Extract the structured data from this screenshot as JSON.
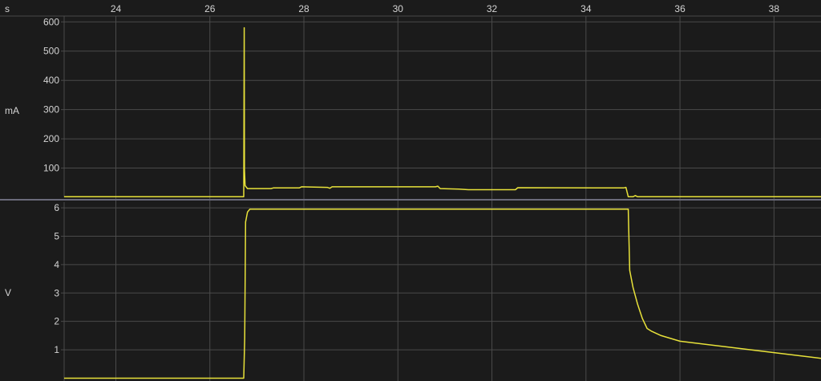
{
  "window": {
    "background": "#1b1b1b",
    "grid_color": "#4a4a4a",
    "divider_color": "#6a6a7a",
    "text_color": "#d4d4d4",
    "trace_color": "#e8e23a"
  },
  "chart_data": [
    {
      "type": "line",
      "panel": "current",
      "xlabel": "s",
      "ylabel": "mA",
      "xlim": [
        22.9,
        39.0
      ],
      "ylim": [
        0,
        620
      ],
      "x_ticks": [
        24,
        26,
        28,
        30,
        32,
        34,
        36,
        38
      ],
      "y_ticks": [
        100,
        200,
        300,
        400,
        500,
        600
      ],
      "grid": true,
      "series": [
        {
          "points": [
            [
              22.9,
              2
            ],
            [
              26.5,
              2
            ],
            [
              26.72,
              2
            ],
            [
              26.73,
              580
            ],
            [
              26.735,
              95
            ],
            [
              26.75,
              40
            ],
            [
              26.8,
              30
            ],
            [
              27.3,
              30
            ],
            [
              27.35,
              32
            ],
            [
              27.9,
              32
            ],
            [
              27.95,
              36
            ],
            [
              28.5,
              34
            ],
            [
              28.55,
              31
            ],
            [
              28.6,
              36
            ],
            [
              30.8,
              36
            ],
            [
              30.85,
              38
            ],
            [
              30.9,
              30
            ],
            [
              31.3,
              28
            ],
            [
              31.5,
              26
            ],
            [
              32.5,
              26
            ],
            [
              32.55,
              33
            ],
            [
              34.2,
              32
            ],
            [
              34.8,
              32
            ],
            [
              34.85,
              34
            ],
            [
              34.9,
              2
            ],
            [
              35.0,
              2
            ],
            [
              35.05,
              6
            ],
            [
              35.1,
              2
            ],
            [
              39.0,
              2
            ]
          ]
        }
      ]
    },
    {
      "type": "line",
      "panel": "voltage",
      "xlabel": "",
      "ylabel": "V",
      "xlim": [
        22.9,
        39.0
      ],
      "ylim": [
        -0.1,
        6.2
      ],
      "y_ticks": [
        1,
        2,
        3,
        4,
        5,
        6
      ],
      "grid": true,
      "series": [
        {
          "points": [
            [
              22.9,
              0.0
            ],
            [
              26.4,
              0.0
            ],
            [
              26.72,
              0.0
            ],
            [
              26.74,
              1.4
            ],
            [
              26.76,
              5.5
            ],
            [
              26.8,
              5.85
            ],
            [
              26.85,
              5.95
            ],
            [
              30.0,
              5.95
            ],
            [
              34.7,
              5.95
            ],
            [
              34.9,
              5.95
            ],
            [
              34.93,
              3.8
            ],
            [
              35.0,
              3.2
            ],
            [
              35.1,
              2.6
            ],
            [
              35.2,
              2.1
            ],
            [
              35.3,
              1.75
            ],
            [
              35.4,
              1.65
            ],
            [
              35.6,
              1.5
            ],
            [
              36.0,
              1.3
            ],
            [
              37.0,
              1.1
            ],
            [
              38.0,
              0.9
            ],
            [
              39.0,
              0.7
            ]
          ]
        }
      ]
    }
  ]
}
